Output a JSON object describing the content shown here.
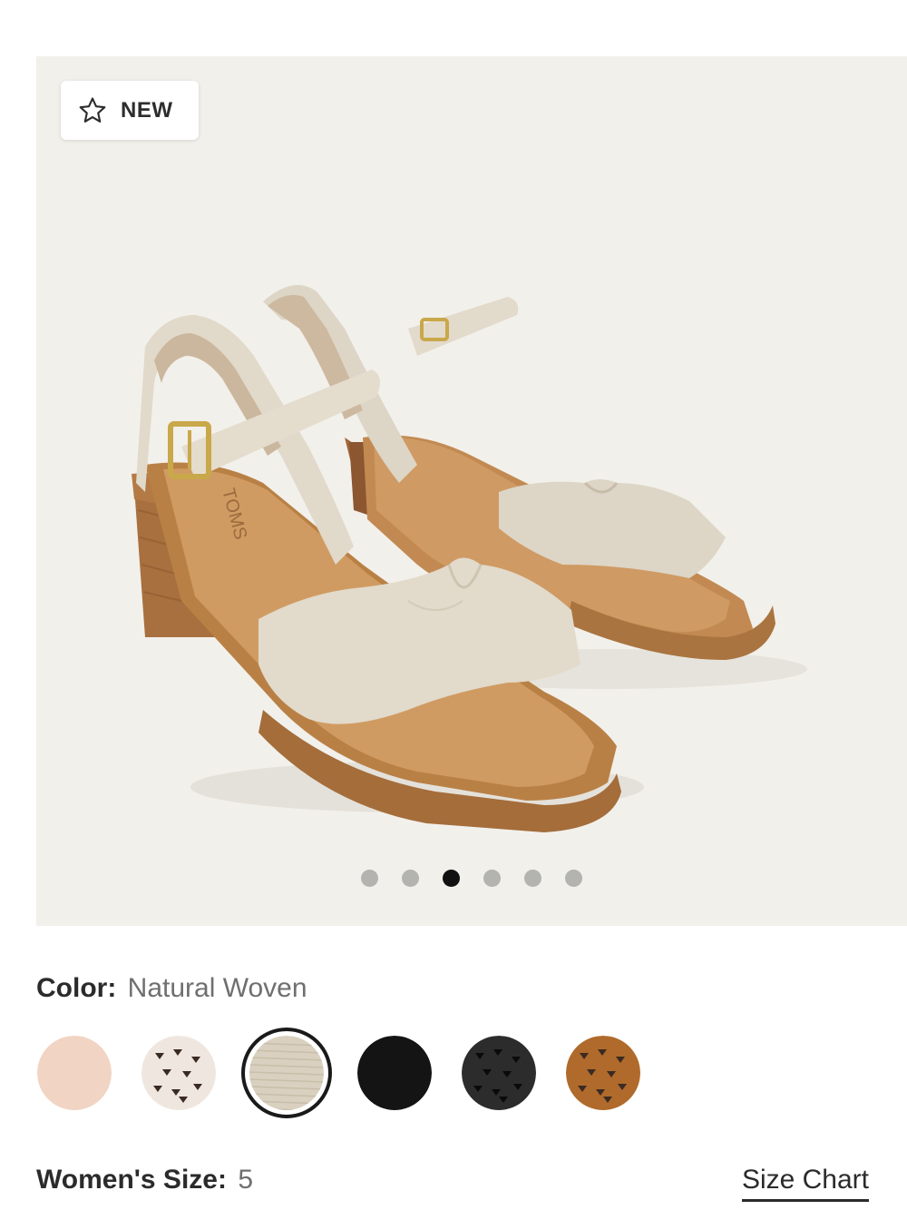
{
  "badge": {
    "label": "NEW",
    "icon": "star-outline-icon"
  },
  "carousel": {
    "total": 6,
    "active_index": 2
  },
  "color": {
    "label": "Color:",
    "selected_name": "Natural Woven",
    "swatches": [
      {
        "name": "blush",
        "base": "#f1d4c3",
        "pattern": "solid"
      },
      {
        "name": "cream-dotted",
        "base": "#efe7df",
        "pattern": "dots-dark"
      },
      {
        "name": "natural-woven",
        "base": "#d9d0bf",
        "pattern": "woven",
        "selected": true
      },
      {
        "name": "black",
        "base": "#141414",
        "pattern": "solid"
      },
      {
        "name": "black-dotted",
        "base": "#2c2c2c",
        "pattern": "dots-black"
      },
      {
        "name": "tan-dotted",
        "base": "#b06a2b",
        "pattern": "dots-dark"
      }
    ]
  },
  "size": {
    "label": "Women's Size:",
    "value": "5",
    "chart_link": "Size Chart"
  }
}
